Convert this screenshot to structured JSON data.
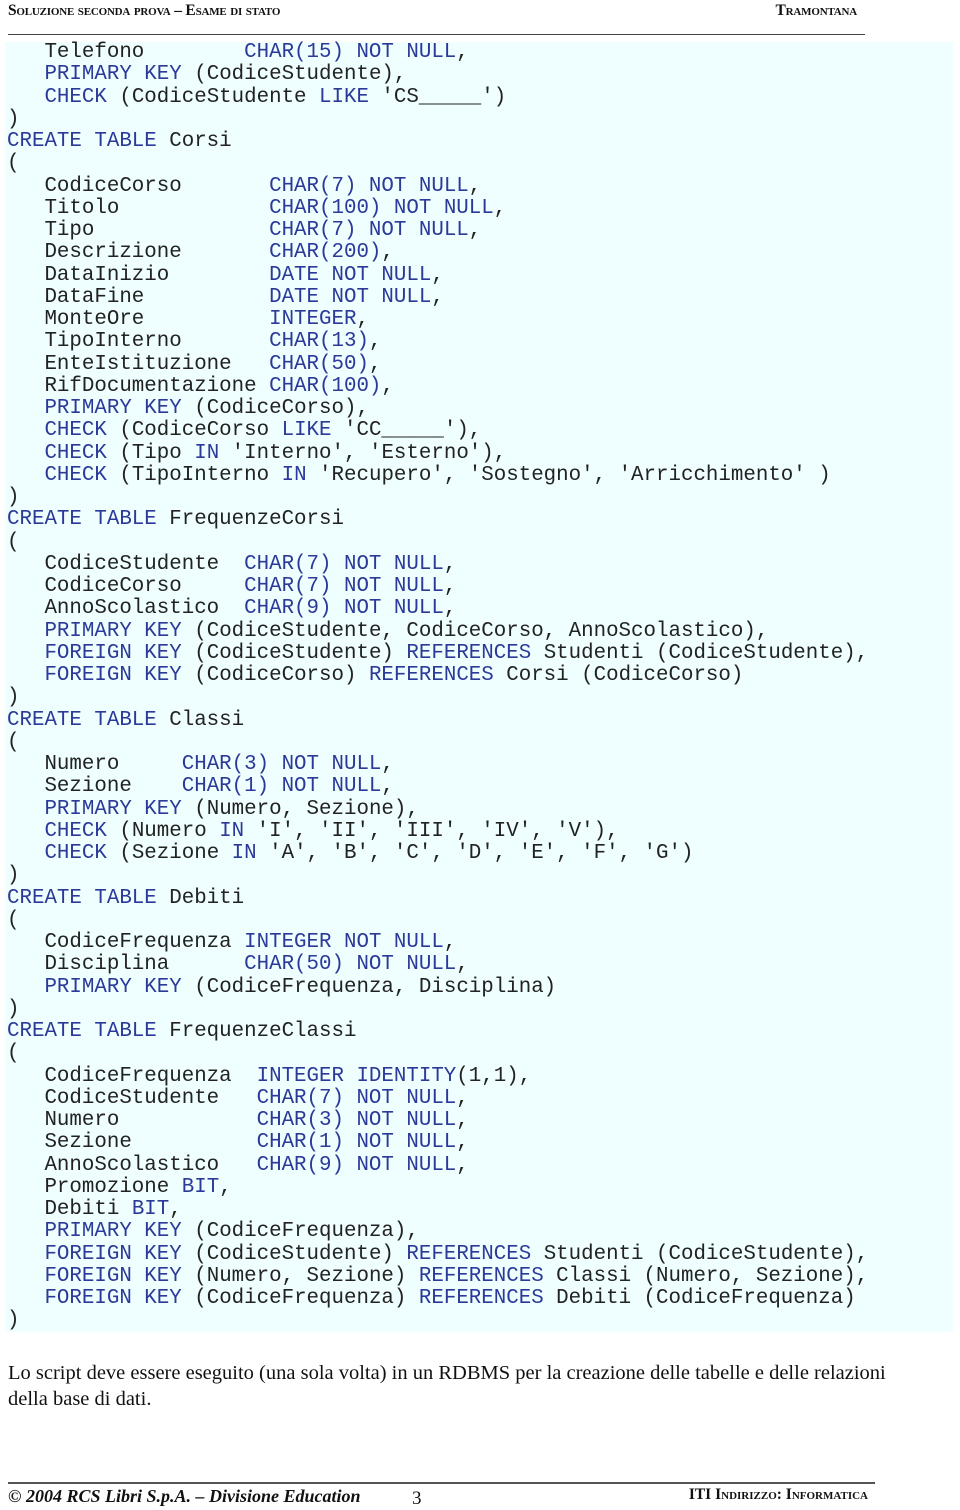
{
  "header": {
    "left": "Soluzione seconda prova – Esame di stato",
    "right": "Tramontana"
  },
  "code": {
    "colors": {
      "keyword": "#2b3a98",
      "text": "#222222",
      "background": "#effefe"
    },
    "lines": [
      [
        [
          "t",
          "   Telefono        "
        ],
        [
          "k",
          "CHAR(15) NOT NULL"
        ],
        [
          "t",
          ","
        ]
      ],
      [
        [
          "t",
          "   "
        ],
        [
          "k",
          "PRIMARY KEY"
        ],
        [
          "t",
          " (CodiceStudente),"
        ]
      ],
      [
        [
          "t",
          "   "
        ],
        [
          "k",
          "CHECK"
        ],
        [
          "t",
          " (CodiceStudente "
        ],
        [
          "k",
          "LIKE"
        ],
        [
          "t",
          " 'CS_____')"
        ]
      ],
      [
        [
          "t",
          ")"
        ]
      ],
      [
        [
          "k",
          "CREATE TABLE"
        ],
        [
          "t",
          " Corsi"
        ]
      ],
      [
        [
          "t",
          "("
        ]
      ],
      [
        [
          "t",
          "   CodiceCorso       "
        ],
        [
          "k",
          "CHAR(7) NOT NULL"
        ],
        [
          "t",
          ","
        ]
      ],
      [
        [
          "t",
          "   Titolo            "
        ],
        [
          "k",
          "CHAR(100) NOT NULL"
        ],
        [
          "t",
          ","
        ]
      ],
      [
        [
          "t",
          "   Tipo              "
        ],
        [
          "k",
          "CHAR(7) NOT NULL"
        ],
        [
          "t",
          ","
        ]
      ],
      [
        [
          "t",
          "   Descrizione       "
        ],
        [
          "k",
          "CHAR(200)"
        ],
        [
          "t",
          ","
        ]
      ],
      [
        [
          "t",
          "   DataInizio        "
        ],
        [
          "k",
          "DATE NOT NULL"
        ],
        [
          "t",
          ","
        ]
      ],
      [
        [
          "t",
          "   DataFine          "
        ],
        [
          "k",
          "DATE NOT NULL"
        ],
        [
          "t",
          ","
        ]
      ],
      [
        [
          "t",
          "   MonteOre          "
        ],
        [
          "k",
          "INTEGER"
        ],
        [
          "t",
          ","
        ]
      ],
      [
        [
          "t",
          "   TipoInterno       "
        ],
        [
          "k",
          "CHAR(13)"
        ],
        [
          "t",
          ","
        ]
      ],
      [
        [
          "t",
          "   EnteIstituzione   "
        ],
        [
          "k",
          "CHAR(50)"
        ],
        [
          "t",
          ","
        ]
      ],
      [
        [
          "t",
          "   RifDocumentazione "
        ],
        [
          "k",
          "CHAR(100)"
        ],
        [
          "t",
          ","
        ]
      ],
      [
        [
          "t",
          "   "
        ],
        [
          "k",
          "PRIMARY KEY"
        ],
        [
          "t",
          " (CodiceCorso),"
        ]
      ],
      [
        [
          "t",
          "   "
        ],
        [
          "k",
          "CHECK"
        ],
        [
          "t",
          " (CodiceCorso "
        ],
        [
          "k",
          "LIKE"
        ],
        [
          "t",
          " 'CC_____'),"
        ]
      ],
      [
        [
          "t",
          "   "
        ],
        [
          "k",
          "CHECK"
        ],
        [
          "t",
          " (Tipo "
        ],
        [
          "k",
          "IN"
        ],
        [
          "t",
          " 'Interno', 'Esterno'),"
        ]
      ],
      [
        [
          "t",
          "   "
        ],
        [
          "k",
          "CHECK"
        ],
        [
          "t",
          " (TipoInterno "
        ],
        [
          "k",
          "IN"
        ],
        [
          "t",
          " 'Recupero', 'Sostegno', 'Arricchimento' )"
        ]
      ],
      [
        [
          "t",
          ")"
        ]
      ],
      [
        [
          "k",
          "CREATE TABLE"
        ],
        [
          "t",
          " FrequenzeCorsi"
        ]
      ],
      [
        [
          "t",
          "("
        ]
      ],
      [
        [
          "t",
          "   CodiceStudente  "
        ],
        [
          "k",
          "CHAR(7) NOT NULL"
        ],
        [
          "t",
          ","
        ]
      ],
      [
        [
          "t",
          "   CodiceCorso     "
        ],
        [
          "k",
          "CHAR(7) NOT NULL"
        ],
        [
          "t",
          ","
        ]
      ],
      [
        [
          "t",
          "   AnnoScolastico  "
        ],
        [
          "k",
          "CHAR(9) NOT NULL"
        ],
        [
          "t",
          ","
        ]
      ],
      [
        [
          "t",
          "   "
        ],
        [
          "k",
          "PRIMARY KEY"
        ],
        [
          "t",
          " (CodiceStudente, CodiceCorso, AnnoScolastico),"
        ]
      ],
      [
        [
          "t",
          "   "
        ],
        [
          "k",
          "FOREIGN KEY"
        ],
        [
          "t",
          " (CodiceStudente) "
        ],
        [
          "k",
          "REFERENCES"
        ],
        [
          "t",
          " Studenti (CodiceStudente),"
        ]
      ],
      [
        [
          "t",
          "   "
        ],
        [
          "k",
          "FOREIGN KEY"
        ],
        [
          "t",
          " (CodiceCorso) "
        ],
        [
          "k",
          "REFERENCES"
        ],
        [
          "t",
          " Corsi (CodiceCorso)"
        ]
      ],
      [
        [
          "t",
          ")"
        ]
      ],
      [
        [
          "k",
          "CREATE TABLE"
        ],
        [
          "t",
          " Classi"
        ]
      ],
      [
        [
          "t",
          "("
        ]
      ],
      [
        [
          "t",
          "   Numero     "
        ],
        [
          "k",
          "CHAR(3) NOT NULL"
        ],
        [
          "t",
          ","
        ]
      ],
      [
        [
          "t",
          "   Sezione    "
        ],
        [
          "k",
          "CHAR(1) NOT NULL"
        ],
        [
          "t",
          ","
        ]
      ],
      [
        [
          "t",
          "   "
        ],
        [
          "k",
          "PRIMARY KEY"
        ],
        [
          "t",
          " (Numero, Sezione),"
        ]
      ],
      [
        [
          "t",
          "   "
        ],
        [
          "k",
          "CHECK"
        ],
        [
          "t",
          " (Numero "
        ],
        [
          "k",
          "IN"
        ],
        [
          "t",
          " 'I', 'II', 'III', 'IV', 'V'),"
        ]
      ],
      [
        [
          "t",
          "   "
        ],
        [
          "k",
          "CHECK"
        ],
        [
          "t",
          " (Sezione "
        ],
        [
          "k",
          "IN"
        ],
        [
          "t",
          " 'A', 'B', 'C', 'D', 'E', 'F', 'G')"
        ]
      ],
      [
        [
          "t",
          ")"
        ]
      ],
      [
        [
          "k",
          "CREATE TABLE"
        ],
        [
          "t",
          " Debiti"
        ]
      ],
      [
        [
          "t",
          "("
        ]
      ],
      [
        [
          "t",
          "   CodiceFrequenza "
        ],
        [
          "k",
          "INTEGER NOT NULL"
        ],
        [
          "t",
          ","
        ]
      ],
      [
        [
          "t",
          "   Disciplina      "
        ],
        [
          "k",
          "CHAR(50) NOT NULL"
        ],
        [
          "t",
          ","
        ]
      ],
      [
        [
          "t",
          "   "
        ],
        [
          "k",
          "PRIMARY KEY"
        ],
        [
          "t",
          " (CodiceFrequenza, Disciplina)"
        ]
      ],
      [
        [
          "t",
          ")"
        ]
      ],
      [
        [
          "k",
          "CREATE TABLE"
        ],
        [
          "t",
          " FrequenzeClassi"
        ]
      ],
      [
        [
          "t",
          "("
        ]
      ],
      [
        [
          "t",
          "   CodiceFrequenza  "
        ],
        [
          "k",
          "INTEGER IDENTITY"
        ],
        [
          "t",
          "(1,1),"
        ]
      ],
      [
        [
          "t",
          "   CodiceStudente   "
        ],
        [
          "k",
          "CHAR(7) NOT NULL"
        ],
        [
          "t",
          ","
        ]
      ],
      [
        [
          "t",
          "   Numero           "
        ],
        [
          "k",
          "CHAR(3) NOT NULL"
        ],
        [
          "t",
          ","
        ]
      ],
      [
        [
          "t",
          "   Sezione          "
        ],
        [
          "k",
          "CHAR(1) NOT NULL"
        ],
        [
          "t",
          ","
        ]
      ],
      [
        [
          "t",
          "   AnnoScolastico   "
        ],
        [
          "k",
          "CHAR(9) NOT NULL"
        ],
        [
          "t",
          ","
        ]
      ],
      [
        [
          "t",
          "   Promozione "
        ],
        [
          "k",
          "BIT"
        ],
        [
          "t",
          ","
        ]
      ],
      [
        [
          "t",
          "   Debiti "
        ],
        [
          "k",
          "BIT"
        ],
        [
          "t",
          ","
        ]
      ],
      [
        [
          "t",
          "   "
        ],
        [
          "k",
          "PRIMARY KEY"
        ],
        [
          "t",
          " (CodiceFrequenza),"
        ]
      ],
      [
        [
          "t",
          "   "
        ],
        [
          "k",
          "FOREIGN KEY"
        ],
        [
          "t",
          " (CodiceStudente) "
        ],
        [
          "k",
          "REFERENCES"
        ],
        [
          "t",
          " Studenti (CodiceStudente),"
        ]
      ],
      [
        [
          "t",
          "   "
        ],
        [
          "k",
          "FOREIGN KEY"
        ],
        [
          "t",
          " (Numero, Sezione) "
        ],
        [
          "k",
          "REFERENCES"
        ],
        [
          "t",
          " Classi (Numero, Sezione),"
        ]
      ],
      [
        [
          "t",
          "   "
        ],
        [
          "k",
          "FOREIGN KEY"
        ],
        [
          "t",
          " (CodiceFrequenza) "
        ],
        [
          "k",
          "REFERENCES"
        ],
        [
          "t",
          " Debiti (CodiceFrequenza)"
        ]
      ],
      [
        [
          "t",
          ")"
        ]
      ]
    ]
  },
  "note": "Lo script deve essere eseguito (una sola volta) in un RDBMS per la creazione delle tabelle e delle relazioni della base di dati.",
  "footer": {
    "left": "© 2004 RCS Libri S.p.A. – Divisione Education",
    "page_number": "3",
    "right": "ITI Indirizzo: Informatica"
  }
}
